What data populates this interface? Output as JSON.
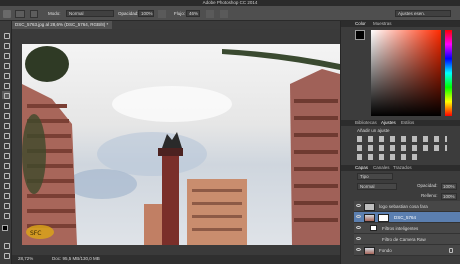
{
  "app": {
    "title": "Adobe Photoshop CC 2014"
  },
  "options_bar": {
    "mode_label": "Modo:",
    "mode_value": "Normal",
    "opacity_label": "Opacidad:",
    "opacity_value": "100%",
    "flow_label": "Flujo:",
    "flow_value": "46%",
    "workspace_value": "Ajustes esen."
  },
  "document": {
    "tab_label": "DSC_5763.jpg al 28,6% (DSC_5764, RGB/8) *",
    "zoom": "28,72%",
    "doc_size": "Doc: 95,5 MB/130,0 MB"
  },
  "panels": {
    "color": {
      "tabs": [
        "Color",
        "Muestras"
      ]
    },
    "adjustments": {
      "tabs": [
        "Bibliotecas",
        "Ajustes",
        "Estilos"
      ],
      "subtitle": "Añadir un ajuste"
    },
    "layers": {
      "tabs": [
        "Capas",
        "Canales",
        "Trazados"
      ],
      "filter": "Tipo",
      "blend": "Normal",
      "opacity_label": "Opacidad:",
      "opacity_value": "100%",
      "fill_label": "Relleno:",
      "fill_value": "100%",
      "items": [
        {
          "name": "logo sebastian cosa fara"
        },
        {
          "name": "DSC_5764"
        },
        {
          "name": "Filtros inteligentes"
        },
        {
          "name": "Filtro de Camera Raw"
        },
        {
          "name": "Fondo"
        }
      ]
    }
  },
  "colors": {
    "accent": "#5b7fb0",
    "foreground": "#000000",
    "background": "#ffffff"
  },
  "icons": [
    "move-tool-icon",
    "marquee-tool-icon",
    "lasso-tool-icon",
    "crop-tool-icon",
    "brush-tool-icon",
    "eye-icon",
    "lock-icon",
    "fx-icon"
  ]
}
